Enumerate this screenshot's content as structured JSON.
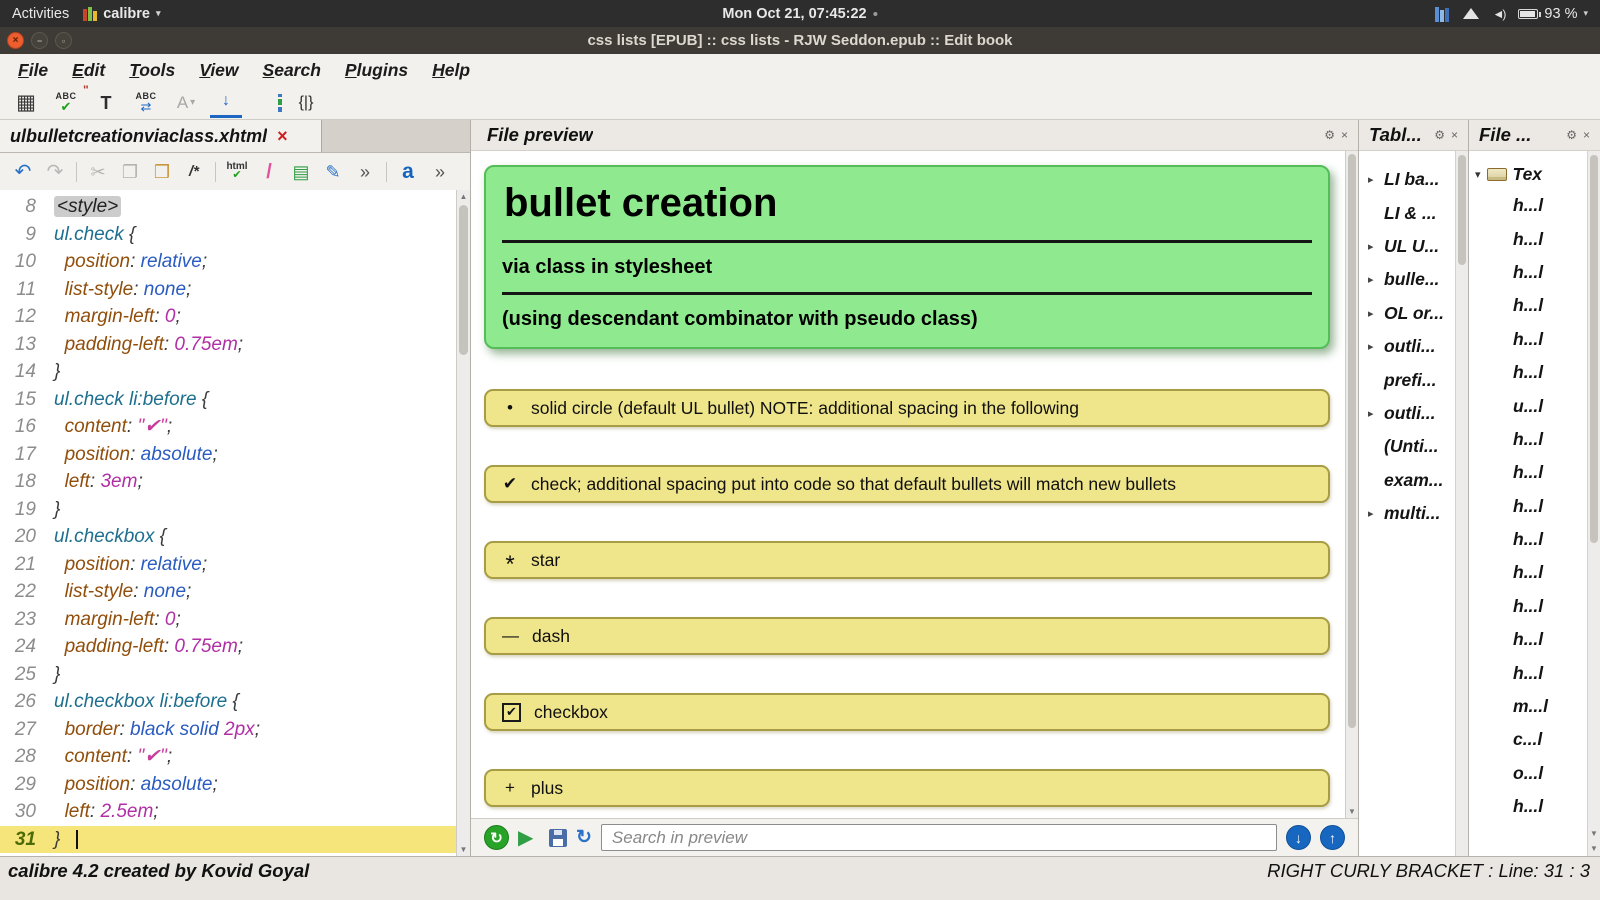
{
  "system_bar": {
    "activities_label": "Activities",
    "app_name": "calibre",
    "clock": "Mon Oct 21, 07:45:22",
    "battery_label": "93 %"
  },
  "window": {
    "title": "css lists [EPUB] :: css lists - RJW Seddon.epub :: Edit book"
  },
  "menus": [
    "File",
    "Edit",
    "Tools",
    "View",
    "Search",
    "Plugins",
    "Help"
  ],
  "toolbar": {
    "spell_text": "ABC",
    "case_text": "T",
    "replace_text": "ABC",
    "arrange_text": "A",
    "braces_text": "{|}"
  },
  "editor": {
    "tab_title": "ulbulletcreationviaclass.xhtml",
    "toolbar": {
      "comment_text": "/*",
      "html_text": "html",
      "slash_text": "/",
      "live_css_text": "a",
      "overflow_text": "»"
    }
  },
  "code": {
    "lines": [
      {
        "n": 8,
        "tokens": [
          [
            "taghl",
            "<style>"
          ]
        ]
      },
      {
        "n": 9,
        "tokens": [
          [
            "sel",
            "ul.check"
          ],
          [
            "pu",
            " {"
          ]
        ]
      },
      {
        "n": 10,
        "tokens": [
          [
            "pu",
            "  "
          ],
          [
            "prop",
            "position"
          ],
          [
            "pu",
            ": "
          ],
          [
            "val",
            "relative"
          ],
          [
            "pu",
            ";"
          ]
        ]
      },
      {
        "n": 11,
        "tokens": [
          [
            "pu",
            "  "
          ],
          [
            "prop",
            "list-style"
          ],
          [
            "pu",
            ": "
          ],
          [
            "val",
            "none"
          ],
          [
            "pu",
            ";"
          ]
        ]
      },
      {
        "n": 12,
        "tokens": [
          [
            "pu",
            "  "
          ],
          [
            "prop",
            "margin-left"
          ],
          [
            "pu",
            ": "
          ],
          [
            "num",
            "0"
          ],
          [
            "pu",
            ";"
          ]
        ]
      },
      {
        "n": 13,
        "tokens": [
          [
            "pu",
            "  "
          ],
          [
            "prop",
            "padding-left"
          ],
          [
            "pu",
            ": "
          ],
          [
            "num",
            "0.75em"
          ],
          [
            "pu",
            ";"
          ]
        ]
      },
      {
        "n": 14,
        "tokens": [
          [
            "pu",
            "}"
          ]
        ]
      },
      {
        "n": 15,
        "tokens": [
          [
            "sel",
            "ul.check li:before"
          ],
          [
            "pu",
            " {"
          ]
        ]
      },
      {
        "n": 16,
        "tokens": [
          [
            "pu",
            "  "
          ],
          [
            "prop",
            "content"
          ],
          [
            "pu",
            ": "
          ],
          [
            "str",
            "\"✔\""
          ],
          [
            "pu",
            ";"
          ]
        ]
      },
      {
        "n": 17,
        "tokens": [
          [
            "pu",
            "  "
          ],
          [
            "prop",
            "position"
          ],
          [
            "pu",
            ": "
          ],
          [
            "val",
            "absolute"
          ],
          [
            "pu",
            ";"
          ]
        ]
      },
      {
        "n": 18,
        "tokens": [
          [
            "pu",
            "  "
          ],
          [
            "prop",
            "left"
          ],
          [
            "pu",
            ": "
          ],
          [
            "num",
            "3em"
          ],
          [
            "pu",
            ";"
          ]
        ]
      },
      {
        "n": 19,
        "tokens": [
          [
            "pu",
            "}"
          ]
        ]
      },
      {
        "n": 20,
        "tokens": [
          [
            "sel",
            "ul.checkbox"
          ],
          [
            "pu",
            " {"
          ]
        ]
      },
      {
        "n": 21,
        "tokens": [
          [
            "pu",
            "  "
          ],
          [
            "prop",
            "position"
          ],
          [
            "pu",
            ": "
          ],
          [
            "val",
            "relative"
          ],
          [
            "pu",
            ";"
          ]
        ]
      },
      {
        "n": 22,
        "tokens": [
          [
            "pu",
            "  "
          ],
          [
            "prop",
            "list-style"
          ],
          [
            "pu",
            ": "
          ],
          [
            "val",
            "none"
          ],
          [
            "pu",
            ";"
          ]
        ]
      },
      {
        "n": 23,
        "tokens": [
          [
            "pu",
            "  "
          ],
          [
            "prop",
            "margin-left"
          ],
          [
            "pu",
            ": "
          ],
          [
            "num",
            "0"
          ],
          [
            "pu",
            ";"
          ]
        ]
      },
      {
        "n": 24,
        "tokens": [
          [
            "pu",
            "  "
          ],
          [
            "prop",
            "padding-left"
          ],
          [
            "pu",
            ": "
          ],
          [
            "num",
            "0.75em"
          ],
          [
            "pu",
            ";"
          ]
        ]
      },
      {
        "n": 25,
        "tokens": [
          [
            "pu",
            "}"
          ]
        ]
      },
      {
        "n": 26,
        "tokens": [
          [
            "sel",
            "ul.checkbox li:before"
          ],
          [
            "pu",
            " {"
          ]
        ]
      },
      {
        "n": 27,
        "tokens": [
          [
            "pu",
            "  "
          ],
          [
            "prop",
            "border"
          ],
          [
            "pu",
            ": "
          ],
          [
            "val",
            "black solid "
          ],
          [
            "num",
            "2px"
          ],
          [
            "pu",
            ";"
          ]
        ]
      },
      {
        "n": 28,
        "tokens": [
          [
            "pu",
            "  "
          ],
          [
            "prop",
            "content"
          ],
          [
            "pu",
            ": "
          ],
          [
            "str",
            "\"✔\""
          ],
          [
            "pu",
            ";"
          ]
        ]
      },
      {
        "n": 29,
        "tokens": [
          [
            "pu",
            "  "
          ],
          [
            "prop",
            "position"
          ],
          [
            "pu",
            ": "
          ],
          [
            "val",
            "absolute"
          ],
          [
            "pu",
            ";"
          ]
        ]
      },
      {
        "n": 30,
        "tokens": [
          [
            "pu",
            "  "
          ],
          [
            "prop",
            "left"
          ],
          [
            "pu",
            ": "
          ],
          [
            "num",
            "2.5em"
          ],
          [
            "pu",
            ";"
          ]
        ]
      },
      {
        "n": 31,
        "tokens": [
          [
            "pu",
            "}"
          ]
        ],
        "current": true
      }
    ]
  },
  "preview": {
    "title": "File preview",
    "heading": "bullet creation",
    "subheading1": "via class in stylesheet",
    "subheading2": "(using descendant combinator with pseudo class)",
    "items": [
      {
        "type": "bullet",
        "marker": "•",
        "text": "solid circle (default UL bullet) NOTE: additional spacing in the following"
      },
      {
        "type": "check",
        "marker": "✔",
        "text": "check; additional spacing put into code so that default bullets will match new bullets"
      },
      {
        "type": "star",
        "marker": "*",
        "text": "star"
      },
      {
        "type": "dash",
        "marker": "—",
        "text": "dash"
      },
      {
        "type": "checkbox",
        "marker": "✔",
        "text": "checkbox"
      },
      {
        "type": "plus",
        "marker": "+",
        "text": "plus"
      }
    ],
    "search_placeholder": "Search in preview"
  },
  "toc_panel": {
    "title": "Tabl...",
    "items": [
      {
        "label": "LI ba...",
        "arrow": true
      },
      {
        "label": "LI & ...",
        "arrow": false
      },
      {
        "label": "UL U...",
        "arrow": true
      },
      {
        "label": "bulle...",
        "arrow": true
      },
      {
        "label": "OL or...",
        "arrow": true
      },
      {
        "label": "outli...",
        "arrow": true
      },
      {
        "label": "prefi...",
        "arrow": false
      },
      {
        "label": "outli...",
        "arrow": true
      },
      {
        "label": "(Unti...",
        "arrow": false
      },
      {
        "label": "exam...",
        "arrow": false
      },
      {
        "label": "multi...",
        "arrow": true
      }
    ]
  },
  "files_panel": {
    "title": "File ...",
    "root_label": "Tex",
    "items": [
      "h...l",
      "h...l",
      "h...l",
      "h...l",
      "h...l",
      "h...l",
      "u...l",
      "h...l",
      "h...l",
      "h...l",
      "h...l",
      "h...l",
      "h...l",
      "h...l",
      "h...l",
      "m...l",
      "c...l",
      "o...l",
      "h...l"
    ]
  },
  "status_bar": {
    "left": "calibre 4.2 created by Kovid Goyal",
    "right": "RIGHT CURLY BRACKET : Line: 31 : 3"
  }
}
